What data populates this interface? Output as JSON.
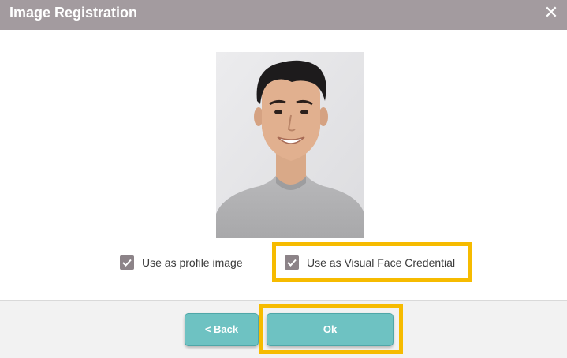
{
  "dialog": {
    "title": "Image Registration",
    "close_symbol": "✕"
  },
  "photo": {
    "icon": "profile-photo"
  },
  "options": {
    "profile_image": {
      "label": "Use as profile image",
      "checked": true
    },
    "face_credential": {
      "label": "Use as Visual Face Credential",
      "checked": true
    }
  },
  "buttons": {
    "back_label": "< Back",
    "ok_label": "Ok"
  },
  "colors": {
    "titlebar": "#a39b9f",
    "button": "#6ec2c2",
    "highlight": "#f6bb00",
    "checkbox": "#8c8388"
  }
}
